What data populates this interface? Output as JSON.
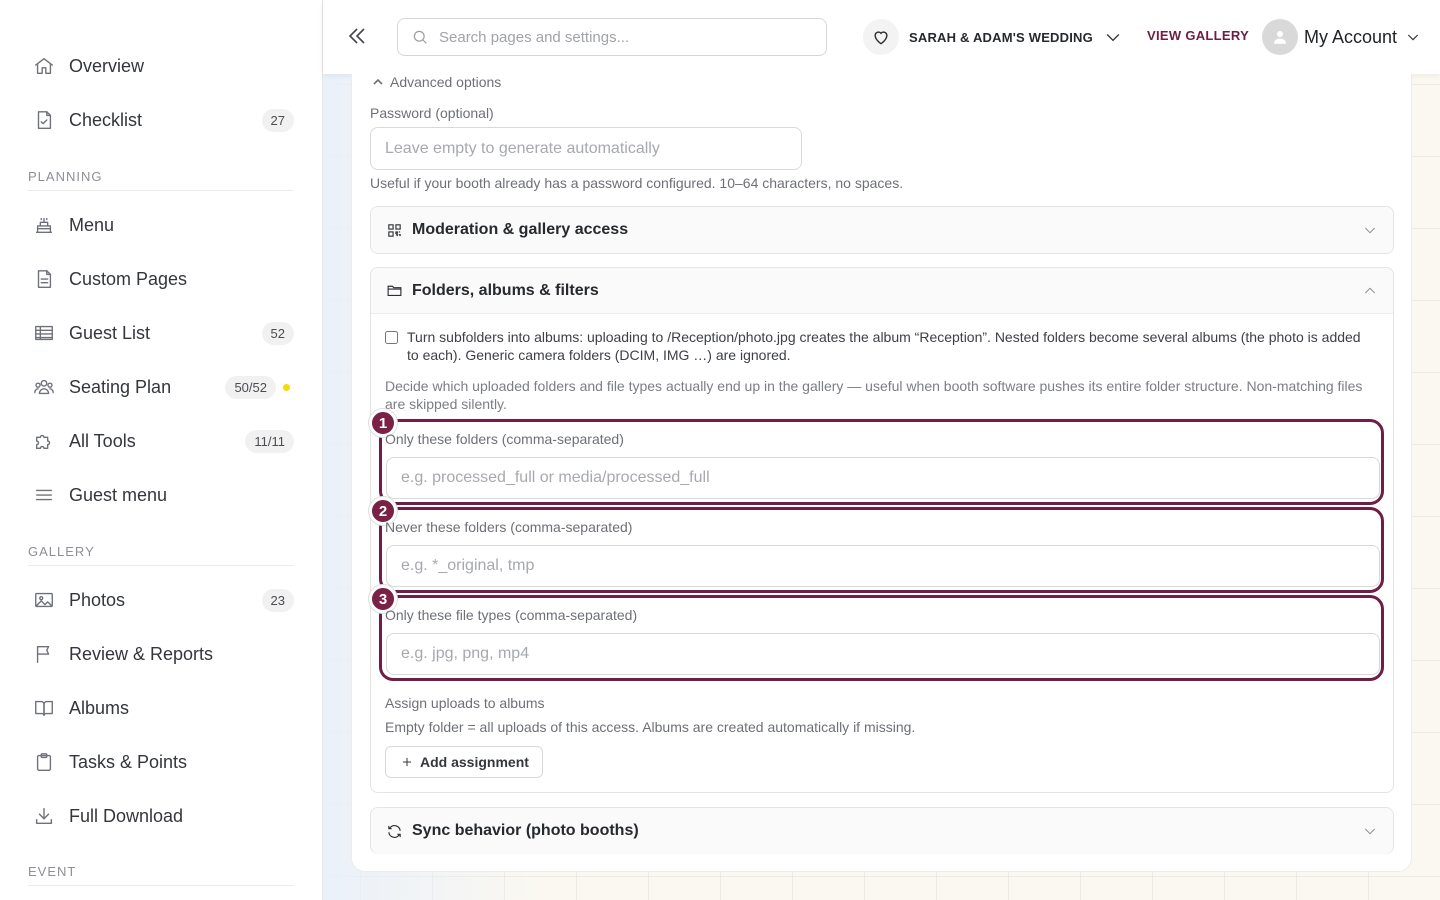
{
  "sidebar": {
    "items": [
      {
        "label": "Overview",
        "icon": "home-icon"
      },
      {
        "label": "Checklist",
        "icon": "checklist-icon",
        "badge": "27"
      },
      {
        "label": "Menu",
        "icon": "cake-icon"
      },
      {
        "label": "Custom Pages",
        "icon": "page-icon"
      },
      {
        "label": "Guest List",
        "icon": "table-icon",
        "badge": "52"
      },
      {
        "label": "Seating Plan",
        "icon": "users-icon",
        "badge": "50/52"
      },
      {
        "label": "All Tools",
        "icon": "puzzle-icon",
        "badge": "11/11"
      },
      {
        "label": "Guest menu",
        "icon": "menu-icon"
      },
      {
        "label": "Photos",
        "icon": "image-icon",
        "badge": "23"
      },
      {
        "label": "Review & Reports",
        "icon": "flag-icon"
      },
      {
        "label": "Albums",
        "icon": "book-icon"
      },
      {
        "label": "Tasks & Points",
        "icon": "clipboard-icon"
      },
      {
        "label": "Full Download",
        "icon": "download-icon"
      }
    ],
    "sections": {
      "planning": "PLANNING",
      "gallery": "GALLERY",
      "event": "EVENT"
    },
    "dot_color": "#f5d90a"
  },
  "topbar": {
    "search_placeholder": "Search pages and settings...",
    "event_name": "SARAH & ADAM'S WEDDING",
    "view_gallery": "VIEW GALLERY",
    "account": "My Account",
    "accent_color": "#6b1f45"
  },
  "form": {
    "advanced_toggle": "Advanced options",
    "password_label": "Password (optional)",
    "password_placeholder": "Leave empty to generate automatically",
    "password_help": "Useful if your booth already has a password configured. 10–64 characters, no spaces.",
    "moderation_title": "Moderation & gallery access",
    "folders_title": "Folders, albums & filters",
    "subfolders_checkbox": "Turn subfolders into albums: uploading to /Reception/photo.jpg creates the album “Reception”. Nested folders become several albums (the photo is added to each). Generic camera folders (DCIM, IMG …) are ignored.",
    "subfolders_checked": false,
    "folders_description": "Decide which uploaded folders and file types actually end up in the gallery — useful when booth software pushes its entire folder structure. Non-matching files are skipped silently.",
    "filters": [
      {
        "step": "1",
        "label": "Only these folders (comma-separated)",
        "placeholder": "e.g. processed_full or media/processed_full"
      },
      {
        "step": "2",
        "label": "Never these folders (comma-separated)",
        "placeholder": "e.g. *_original, tmp"
      },
      {
        "step": "3",
        "label": "Only these file types (comma-separated)",
        "placeholder": "e.g. jpg, png, mp4"
      }
    ],
    "assign_label": "Assign uploads to albums",
    "assign_help": "Empty folder = all uploads of this access. Albums are created automatically if missing.",
    "add_assignment": "Add assignment",
    "sync_title": "Sync behavior (photo booths)",
    "highlight_color": "#6e1f47"
  }
}
